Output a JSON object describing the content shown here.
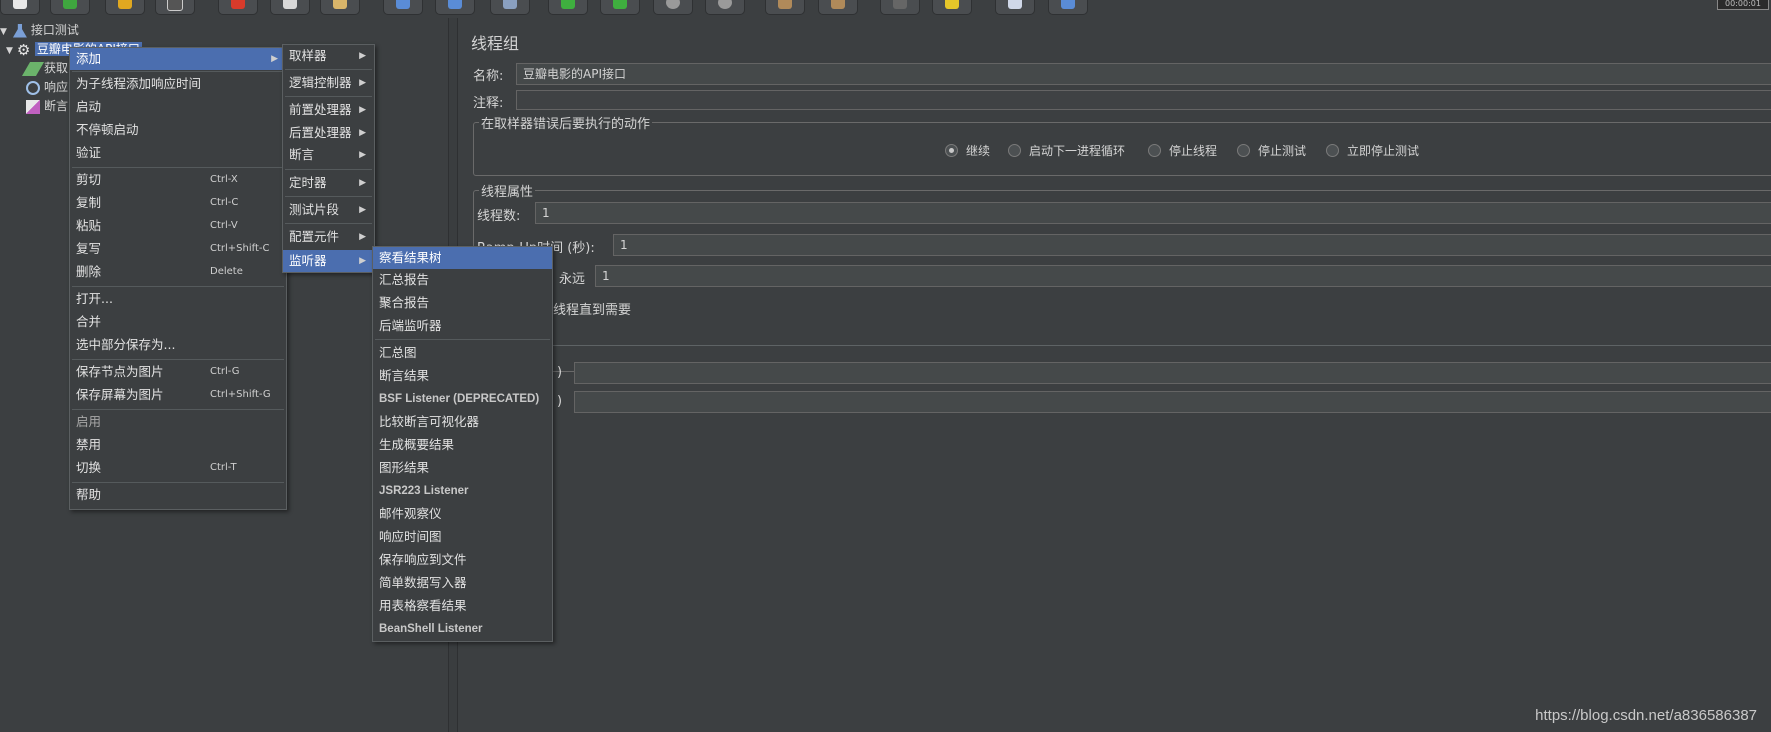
{
  "toolbar": {
    "clock": "00:00:01"
  },
  "tree": {
    "root": "接口测试",
    "thread_group": "豆瓣电影的API接口",
    "children": [
      "获取",
      "响应",
      "断言"
    ]
  },
  "panel": {
    "title": "线程组",
    "name_label": "名称:",
    "name_value": "豆瓣电影的API接口",
    "comment_label": "注释:",
    "error_section": "在取样器错误后要执行的动作",
    "radios": [
      "继续",
      "启动下一进程循环",
      "停止线程",
      "停止测试",
      "立即停止测试"
    ],
    "props_section": "线程属性",
    "threads_label": "线程数:",
    "threads_value": "1",
    "rampup_label": "Ramp-Up时间 (秒):",
    "rampup_value": "1",
    "forever_label": "永远",
    "loop_value": "1",
    "delay_label": "线程直到需要",
    "duration_tail": ")",
    "startup_tail": ")"
  },
  "menu_main": [
    {
      "label": "添加",
      "shortcut": ""
    },
    {
      "label": "为子线程添加响应时间",
      "shortcut": ""
    },
    {
      "label": "启动",
      "shortcut": ""
    },
    {
      "label": "不停顿启动",
      "shortcut": ""
    },
    {
      "label": "验证",
      "shortcut": ""
    },
    {
      "label": "剪切",
      "shortcut": "Ctrl-X"
    },
    {
      "label": "复制",
      "shortcut": "Ctrl-C"
    },
    {
      "label": "粘贴",
      "shortcut": "Ctrl-V"
    },
    {
      "label": "复写",
      "shortcut": "Ctrl+Shift-C"
    },
    {
      "label": "删除",
      "shortcut": "Delete"
    },
    {
      "label": "打开...",
      "shortcut": ""
    },
    {
      "label": "合并",
      "shortcut": ""
    },
    {
      "label": "选中部分保存为...",
      "shortcut": ""
    },
    {
      "label": "保存节点为图片",
      "shortcut": "Ctrl-G"
    },
    {
      "label": "保存屏幕为图片",
      "shortcut": "Ctrl+Shift-G"
    },
    {
      "label": "启用",
      "shortcut": ""
    },
    {
      "label": "禁用",
      "shortcut": ""
    },
    {
      "label": "切换",
      "shortcut": "Ctrl-T"
    },
    {
      "label": "帮助",
      "shortcut": ""
    }
  ],
  "menu_add": [
    "取样器",
    "逻辑控制器",
    "前置处理器",
    "后置处理器",
    "断言",
    "定时器",
    "测试片段",
    "配置元件",
    "监听器"
  ],
  "menu_listener": [
    "察看结果树",
    "汇总报告",
    "聚合报告",
    "后端监听器",
    "汇总图",
    "断言结果",
    "BSF Listener (DEPRECATED)",
    "比较断言可视化器",
    "生成概要结果",
    "图形结果",
    "JSR223 Listener",
    "邮件观察仪",
    "响应时间图",
    "保存响应到文件",
    "简单数据写入器",
    "用表格察看结果",
    "BeanShell Listener"
  ],
  "watermark": "https://blog.csdn.net/a836586387"
}
